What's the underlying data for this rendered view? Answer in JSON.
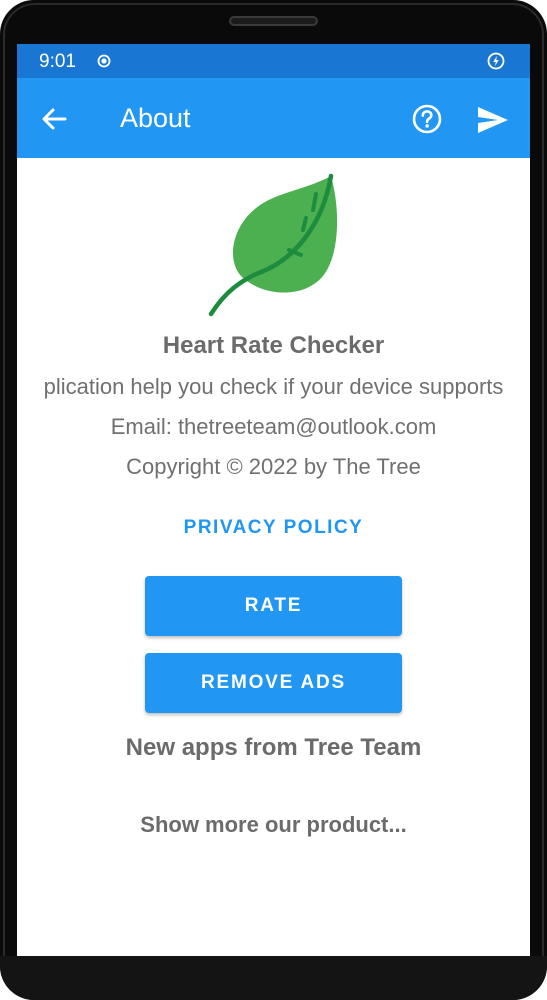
{
  "status_bar": {
    "time": "9:01",
    "icons": [
      "recording-dot-icon",
      "battery-saver-icon"
    ]
  },
  "app_bar": {
    "title": "About",
    "back_icon": "arrow-left-icon",
    "help_icon": "help-circle-icon",
    "send_icon": "send-icon"
  },
  "about": {
    "logo_icon": "leaf-icon",
    "app_name": "Heart Rate Checker",
    "description": "plication help you check if your device supports",
    "email": "Email: thetreeteam@outlook.com",
    "copyright": "Copyright © 2022 by The Tree",
    "privacy_label": "PRIVACY POLICY",
    "rate_label": "RATE",
    "remove_ads_label": "REMOVE ADS",
    "new_apps_heading": "New apps from Tree Team",
    "show_more_label": "Show more our product..."
  },
  "colors": {
    "status_bar": "#1976d2",
    "app_bar": "#2196f3",
    "accent": "#2196f3",
    "text_gray": "#6b6b6b",
    "leaf_fill": "#4caf50",
    "leaf_vein": "#1e8c3f"
  }
}
